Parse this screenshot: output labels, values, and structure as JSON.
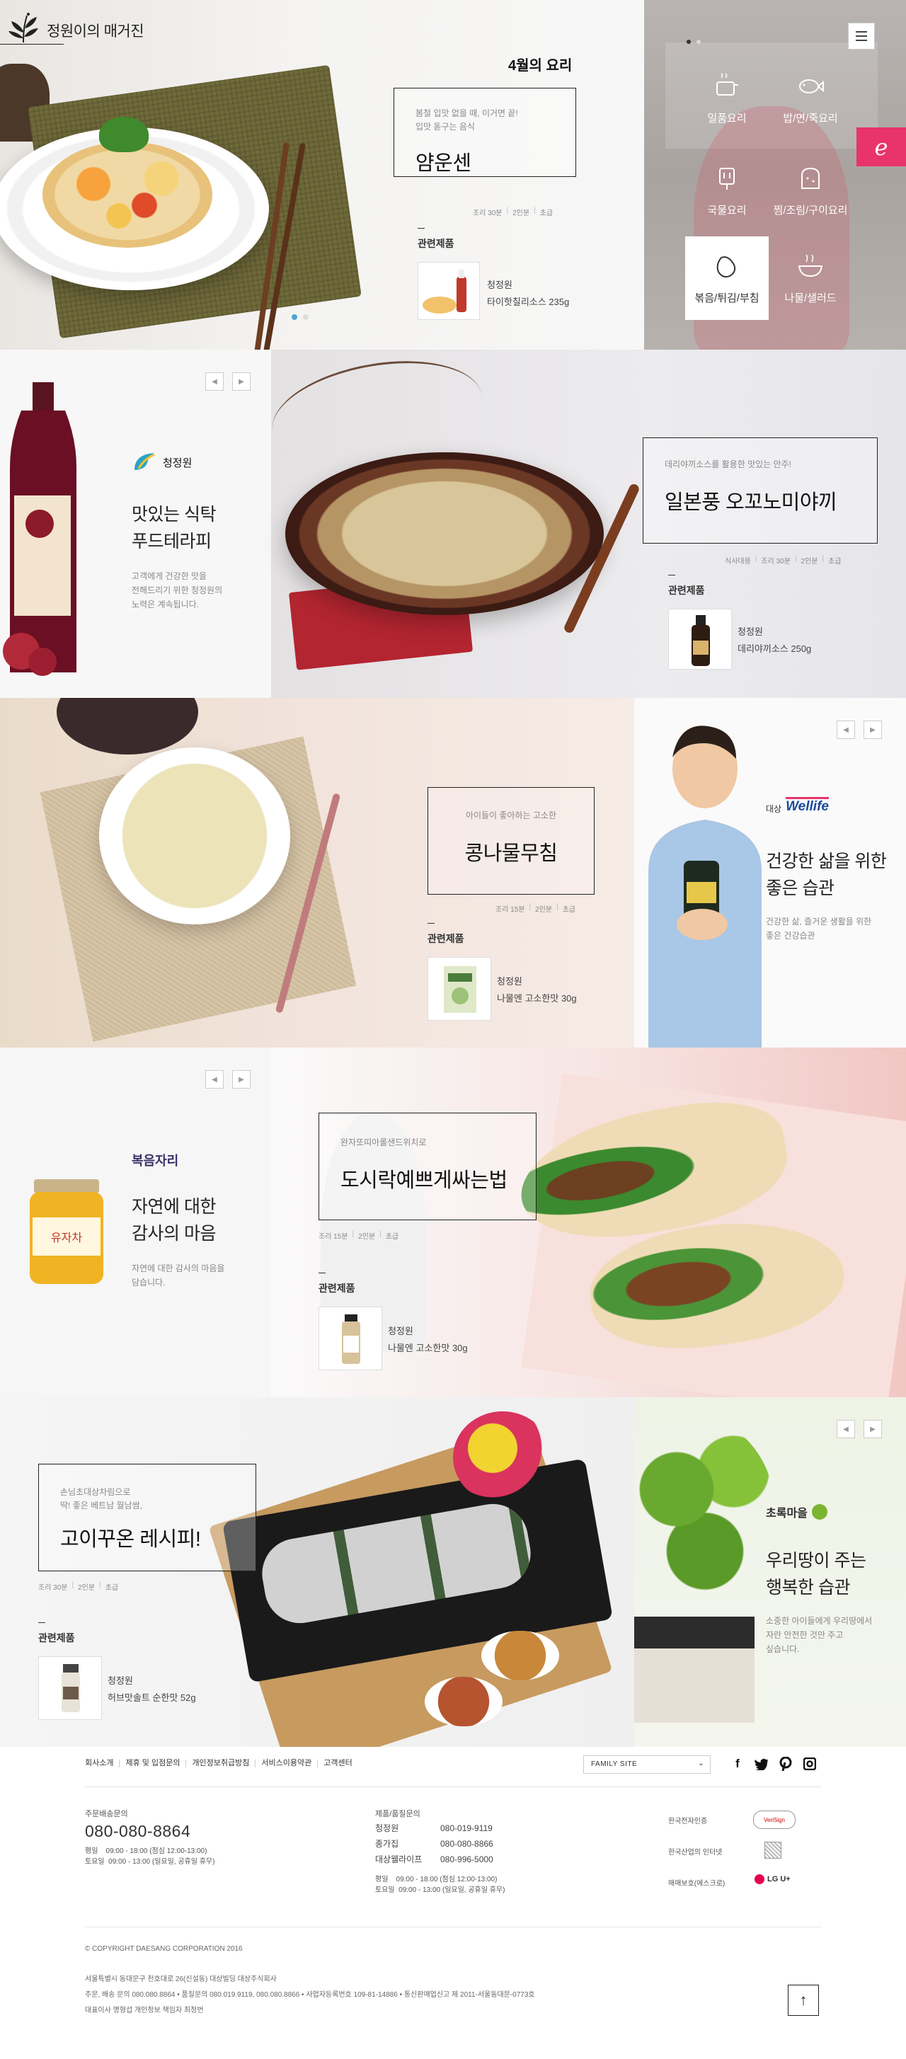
{
  "header": {
    "logo_text": "정원이의 매거진",
    "menu_icon": "hamburger-icon"
  },
  "hero": {
    "section_title": "4월의 요리",
    "recipe": {
      "subtitle_line1": "봄철 입맛 없을 때, 이거면 끝!",
      "subtitle_line2": "입맛 돋구는 음식",
      "title": "얌운센",
      "meta": [
        "조리 30분",
        "2인분",
        "초급"
      ]
    },
    "related_label": "관련제품",
    "product": {
      "brand": "청정원",
      "name": "타이핫칠리소스 235g"
    },
    "pagination": {
      "total": 2,
      "active": 1
    },
    "categories": [
      {
        "label": "일품요리",
        "icon": "pot-icon"
      },
      {
        "label": "밥/면/죽요리",
        "icon": "fish-icon"
      },
      {
        "label": "국물요리",
        "icon": "toaster-icon"
      },
      {
        "label": "찜/조림/구이요리",
        "icon": "bread-icon"
      },
      {
        "label": "볶음/튀김/부침",
        "icon": "egg-icon",
        "active": true
      },
      {
        "label": "나물/샐러드",
        "icon": "bowl-icon"
      }
    ],
    "side_badge": "e",
    "colors": {
      "accent_pink": "#e8346a",
      "dot_active": "#4ea4d6"
    }
  },
  "section2": {
    "brand": "청정원",
    "promo_title_line1": "맛있는 식탁",
    "promo_title_line2": "푸드테라피",
    "promo_desc_line1": "고객에게 건강한 맛을",
    "promo_desc_line2": "전해드리기 위한 청정원의",
    "promo_desc_line3": "노력은 계속됩니다.",
    "recipe": {
      "subtitle": "데리야끼소스를 활용한 맛있는 안주!",
      "title": "일본풍 오꼬노미야끼",
      "meta": [
        "식사대용",
        "조리 30분",
        "2인분",
        "초급"
      ]
    },
    "related_label": "관련제품",
    "product": {
      "brand": "청정원",
      "name": "데리야끼소스 250g"
    }
  },
  "section3": {
    "recipe": {
      "subtitle": "아이들이 좋아하는 고소한",
      "title": "콩나물무침",
      "meta": [
        "조리 15분",
        "2인분",
        "초급"
      ]
    },
    "related_label": "관련제품",
    "product": {
      "brand": "청정원",
      "name": "나물엔 고소한맛 30g"
    },
    "brand_prefix": "대상",
    "brand": "Wellife",
    "promo_title_line1": "건강한 삶을 위한",
    "promo_title_line2": "좋은 습관",
    "promo_desc_line1": "건강한 삶, 즐거운 생활을 위한",
    "promo_desc_line2": "좋은 건강습관"
  },
  "section4": {
    "brand": "복음자리",
    "promo_title_line1": "자연에 대한",
    "promo_title_line2": "감사의 마음",
    "promo_desc_line1": "자연에 대한 감사의 마음을",
    "promo_desc_line2": "담습니다.",
    "jar_label": "유자차",
    "recipe": {
      "subtitle": "완자또띠아롤샌드위치로",
      "title": "도시락예쁘게싸는법",
      "meta": [
        "조리 15분",
        "2인분",
        "초급"
      ]
    },
    "related_label": "관련제품",
    "product": {
      "brand": "청정원",
      "name": "나물엔 고소한맛 30g"
    }
  },
  "section5": {
    "recipe": {
      "subtitle_line1": "손님초대상차림으로",
      "subtitle_line2": "딱! 좋은 베트남 월남쌈,",
      "title": "고이꾸온 레시피!",
      "meta": [
        "조리 30분",
        "2인분",
        "초급"
      ]
    },
    "related_label": "관련제품",
    "product": {
      "brand": "청정원",
      "name": "허브맛솔트 순한맛 52g"
    },
    "brand": "초록마을",
    "promo_title_line1": "우리땅이 주는",
    "promo_title_line2": "행복한 습관",
    "promo_desc_line1": "소중한 아이들에게 우리땅에서",
    "promo_desc_line2": "자란 안전한 것만 주고",
    "promo_desc_line3": "싶습니다."
  },
  "footer": {
    "links": [
      "회사소개",
      "제휴 및 입점문의",
      "개인정보취급방침",
      "서비스이용약관",
      "고객센터"
    ],
    "family_site": "FAMILY SITE",
    "social": [
      "facebook-icon",
      "twitter-icon",
      "pinterest-icon",
      "instagram-icon"
    ],
    "order_label": "주문배송문의",
    "order_phone": "080-080-8864",
    "order_hours_weekday": "평일    09:00 - 18:00 (점심 12:00-13:00)",
    "order_hours_sat": "토요일  09:00 - 13:00 (일요일, 공휴일 휴무)",
    "quality_label": "제품/품질문의",
    "quality_rows": [
      {
        "name": "청정원",
        "phone": "080-019-9119"
      },
      {
        "name": "종가집",
        "phone": "080-080-8866"
      },
      {
        "name": "대상웰라이프",
        "phone": "080-996-5000"
      }
    ],
    "quality_hours_weekday": "평일    09:00 - 18:00 (점심 12:00-13:00)",
    "quality_hours_sat": "토요일  09:00 - 13:00 (일요일, 공휴일 휴무)",
    "certs": [
      {
        "label": "한국전자인증",
        "mark": "VeriSign"
      },
      {
        "label": "한국산업의 인터넷",
        "mark": ""
      },
      {
        "label": "매매보호(에스크로)",
        "mark": "LG U+"
      }
    ],
    "copyright": "© COPYRIGHT DAESANG CORPORATION 2016",
    "address_line1": "서울특별시 동대문구 천호대로 26(신설동) 대상빌딩 대상주식회사",
    "address_line2": "주문, 배송 문의 080.080.8864  •  품질문의 080.019.9119, 080.080.8866  •  사업자등록번호 109-81-14886  •  통신판매업신고 제 2011-서울동대문-0773호",
    "address_line3": "대표이사 명형섭      개인정보 책임자 최정번",
    "to_top": "↑"
  }
}
